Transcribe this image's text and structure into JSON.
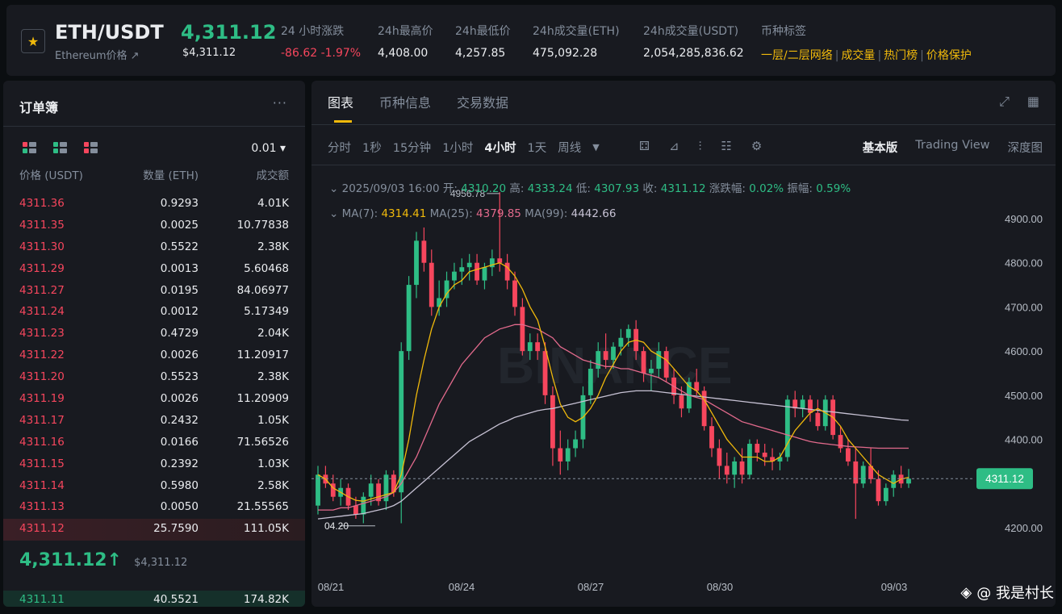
{
  "ticker": {
    "symbol": "ETH/USDT",
    "subtitle": "Ethereum价格 ↗",
    "last_price": "4,311.12",
    "last_price_usd": "$4,311.12",
    "stats": [
      {
        "label": "24 小时涨跌",
        "value": "-86.62 -1.97%",
        "tone": "red"
      },
      {
        "label": "24h最高价",
        "value": "4,408.00",
        "tone": "white"
      },
      {
        "label": "24h最低价",
        "value": "4,257.85",
        "tone": "white"
      },
      {
        "label": "24h成交量(ETH)",
        "value": "475,092.28",
        "tone": "white"
      },
      {
        "label": "24h成交量(USDT)",
        "value": "2,054,285,836.62",
        "tone": "white"
      }
    ],
    "tags_label": "币种标签",
    "tags": [
      "一层/二层网络",
      "成交量",
      "热门榜",
      "价格保护"
    ]
  },
  "orderbook": {
    "title": "订单簿",
    "more": "···",
    "precision": "0.01 ▾",
    "headers": {
      "price": "价格 (USDT)",
      "qty": "数量 (ETH)",
      "total": "成交额"
    },
    "asks": [
      {
        "p": "4311.36",
        "q": "0.9293",
        "t": "4.01K"
      },
      {
        "p": "4311.35",
        "q": "0.0025",
        "t": "10.77838"
      },
      {
        "p": "4311.30",
        "q": "0.5522",
        "t": "2.38K"
      },
      {
        "p": "4311.29",
        "q": "0.0013",
        "t": "5.60468"
      },
      {
        "p": "4311.27",
        "q": "0.0195",
        "t": "84.06977"
      },
      {
        "p": "4311.24",
        "q": "0.0012",
        "t": "5.17349"
      },
      {
        "p": "4311.23",
        "q": "0.4729",
        "t": "2.04K"
      },
      {
        "p": "4311.22",
        "q": "0.0026",
        "t": "11.20917"
      },
      {
        "p": "4311.20",
        "q": "0.5523",
        "t": "2.38K"
      },
      {
        "p": "4311.19",
        "q": "0.0026",
        "t": "11.20909"
      },
      {
        "p": "4311.17",
        "q": "0.2432",
        "t": "1.05K"
      },
      {
        "p": "4311.16",
        "q": "0.0166",
        "t": "71.56526"
      },
      {
        "p": "4311.15",
        "q": "0.2392",
        "t": "1.03K"
      },
      {
        "p": "4311.14",
        "q": "0.5980",
        "t": "2.58K"
      },
      {
        "p": "4311.13",
        "q": "0.0050",
        "t": "21.55565"
      },
      {
        "p": "4311.12",
        "q": "25.7590",
        "t": "111.05K"
      }
    ],
    "mid_price": "4,311.12↑",
    "mid_price_usd": "$4,311.12",
    "bid": {
      "p": "4311.11",
      "q": "40.5521",
      "t": "174.82K"
    }
  },
  "chart_panel": {
    "tabs": [
      "图表",
      "币种信息",
      "交易数据"
    ],
    "active_tab": 0,
    "intervals": [
      "分时",
      "1秒",
      "15分钟",
      "1小时",
      "4小时",
      "1天",
      "周线"
    ],
    "active_interval": 4,
    "views": [
      "基本版",
      "Trading View",
      "深度图"
    ],
    "active_view": 0,
    "ohlc": {
      "time": "2025/09/03 16:00",
      "open_label": "开:",
      "open": "4310.20",
      "high_label": "高:",
      "high": "4333.24",
      "low_label": "低:",
      "low": "4307.93",
      "close_label": "收:",
      "close": "4311.12",
      "change_label": "涨跌幅:",
      "change": "0.02%",
      "amp_label": "振幅:",
      "amp": "0.59%"
    },
    "ma": {
      "ma7_label": "MA(7):",
      "ma7": "4314.41",
      "ma25_label": "MA(25):",
      "ma25": "4379.85",
      "ma99_label": "MA(99):",
      "ma99": "4442.66"
    }
  },
  "chart_data": {
    "type": "candlestick",
    "y_ticks": [
      "4900.00",
      "4800.00",
      "4700.00",
      "4600.00",
      "4500.00",
      "4400.00",
      "4200.00"
    ],
    "ylim": [
      4180,
      4960
    ],
    "x_ticks": [
      "08/21",
      "08/24",
      "08/27",
      "08/30",
      "09/03"
    ],
    "current_price_label": "4311.12",
    "current_price": 4311.12,
    "max_annotation": "4956.78",
    "min_annotation": "04.20",
    "candles": [
      [
        4250,
        4340,
        4230,
        4320
      ],
      [
        4320,
        4340,
        4290,
        4300
      ],
      [
        4300,
        4320,
        4260,
        4270
      ],
      [
        4270,
        4310,
        4250,
        4290
      ],
      [
        4290,
        4300,
        4240,
        4250
      ],
      [
        4250,
        4270,
        4220,
        4230
      ],
      [
        4230,
        4280,
        4210,
        4270
      ],
      [
        4270,
        4320,
        4250,
        4300
      ],
      [
        4300,
        4310,
        4250,
        4260
      ],
      [
        4260,
        4330,
        4240,
        4320
      ],
      [
        4320,
        4330,
        4270,
        4280
      ],
      [
        4280,
        4620,
        4210,
        4600
      ],
      [
        4600,
        4770,
        4580,
        4750
      ],
      [
        4750,
        4870,
        4720,
        4850
      ],
      [
        4850,
        4880,
        4780,
        4800
      ],
      [
        4800,
        4830,
        4680,
        4700
      ],
      [
        4700,
        4760,
        4680,
        4720
      ],
      [
        4720,
        4780,
        4700,
        4760
      ],
      [
        4760,
        4800,
        4740,
        4780
      ],
      [
        4780,
        4810,
        4750,
        4790
      ],
      [
        4790,
        4820,
        4760,
        4800
      ],
      [
        4800,
        4820,
        4750,
        4760
      ],
      [
        4760,
        4800,
        4740,
        4790
      ],
      [
        4790,
        4830,
        4770,
        4810
      ],
      [
        4810,
        4960,
        4780,
        4800
      ],
      [
        4800,
        4820,
        4740,
        4760
      ],
      [
        4760,
        4780,
        4680,
        4700
      ],
      [
        4700,
        4720,
        4590,
        4600
      ],
      [
        4600,
        4640,
        4580,
        4620
      ],
      [
        4620,
        4640,
        4580,
        4600
      ],
      [
        4600,
        4620,
        4480,
        4500
      ],
      [
        4500,
        4520,
        4340,
        4380
      ],
      [
        4380,
        4420,
        4320,
        4350
      ],
      [
        4350,
        4400,
        4330,
        4380
      ],
      [
        4380,
        4420,
        4360,
        4400
      ],
      [
        4400,
        4520,
        4380,
        4500
      ],
      [
        4500,
        4580,
        4480,
        4560
      ],
      [
        4560,
        4620,
        4540,
        4600
      ],
      [
        4600,
        4640,
        4560,
        4580
      ],
      [
        4580,
        4620,
        4560,
        4610
      ],
      [
        4610,
        4650,
        4590,
        4630
      ],
      [
        4630,
        4660,
        4610,
        4650
      ],
      [
        4650,
        4670,
        4580,
        4600
      ],
      [
        4600,
        4610,
        4530,
        4550
      ],
      [
        4550,
        4580,
        4510,
        4560
      ],
      [
        4560,
        4620,
        4540,
        4600
      ],
      [
        4600,
        4610,
        4530,
        4540
      ],
      [
        4540,
        4560,
        4480,
        4500
      ],
      [
        4500,
        4520,
        4450,
        4470
      ],
      [
        4470,
        4540,
        4460,
        4530
      ],
      [
        4530,
        4560,
        4500,
        4510
      ],
      [
        4510,
        4520,
        4420,
        4430
      ],
      [
        4430,
        4450,
        4360,
        4380
      ],
      [
        4380,
        4400,
        4310,
        4340
      ],
      [
        4340,
        4370,
        4300,
        4320
      ],
      [
        4320,
        4360,
        4290,
        4350
      ],
      [
        4350,
        4380,
        4300,
        4320
      ],
      [
        4320,
        4400,
        4310,
        4390
      ],
      [
        4390,
        4400,
        4350,
        4370
      ],
      [
        4370,
        4390,
        4340,
        4360
      ],
      [
        4360,
        4380,
        4330,
        4350
      ],
      [
        4350,
        4370,
        4330,
        4360
      ],
      [
        4360,
        4500,
        4350,
        4490
      ],
      [
        4490,
        4510,
        4450,
        4470
      ],
      [
        4470,
        4500,
        4450,
        4490
      ],
      [
        4490,
        4500,
        4440,
        4460
      ],
      [
        4460,
        4490,
        4420,
        4430
      ],
      [
        4430,
        4500,
        4420,
        4490
      ],
      [
        4490,
        4500,
        4400,
        4410
      ],
      [
        4410,
        4430,
        4370,
        4380
      ],
      [
        4380,
        4400,
        4340,
        4350
      ],
      [
        4350,
        4380,
        4220,
        4300
      ],
      [
        4300,
        4350,
        4290,
        4340
      ],
      [
        4340,
        4380,
        4300,
        4310
      ],
      [
        4310,
        4330,
        4250,
        4260
      ],
      [
        4260,
        4300,
        4250,
        4290
      ],
      [
        4290,
        4330,
        4270,
        4320
      ],
      [
        4320,
        4340,
        4290,
        4300
      ],
      [
        4300,
        4333,
        4290,
        4311
      ]
    ],
    "ma7": [
      4320,
      4310,
      4290,
      4280,
      4270,
      4262,
      4260,
      4265,
      4270,
      4275,
      4280,
      4320,
      4400,
      4500,
      4580,
      4650,
      4700,
      4730,
      4750,
      4760,
      4780,
      4785,
      4790,
      4795,
      4800,
      4790,
      4770,
      4740,
      4700,
      4670,
      4610,
      4540,
      4480,
      4450,
      4440,
      4450,
      4470,
      4500,
      4540,
      4570,
      4600,
      4620,
      4625,
      4620,
      4600,
      4590,
      4580,
      4560,
      4540,
      4520,
      4510,
      4490,
      4460,
      4430,
      4400,
      4380,
      4360,
      4360,
      4360,
      4350,
      4350,
      4360,
      4390,
      4420,
      4440,
      4460,
      4470,
      4460,
      4450,
      4430,
      4400,
      4380,
      4360,
      4340,
      4320,
      4310,
      4300,
      4310,
      4314
    ],
    "ma25": [
      4240,
      4240,
      4240,
      4245,
      4245,
      4250,
      4255,
      4260,
      4265,
      4270,
      4280,
      4300,
      4330,
      4360,
      4400,
      4440,
      4480,
      4510,
      4540,
      4570,
      4590,
      4610,
      4630,
      4640,
      4650,
      4655,
      4660,
      4660,
      4655,
      4650,
      4640,
      4630,
      4610,
      4600,
      4590,
      4580,
      4575,
      4570,
      4565,
      4565,
      4560,
      4560,
      4555,
      4550,
      4545,
      4540,
      4530,
      4520,
      4510,
      4500,
      4495,
      4490,
      4480,
      4470,
      4460,
      4450,
      4440,
      4435,
      4430,
      4425,
      4420,
      4415,
      4410,
      4405,
      4400,
      4395,
      4392,
      4390,
      4388,
      4386,
      4384,
      4383,
      4382,
      4381,
      4380,
      4380,
      4380,
      4380,
      4380
    ],
    "ma99": [
      4220,
      4222,
      4224,
      4226,
      4228,
      4230,
      4232,
      4236,
      4240,
      4244,
      4250,
      4260,
      4275,
      4290,
      4305,
      4320,
      4335,
      4350,
      4365,
      4380,
      4395,
      4405,
      4415,
      4425,
      4435,
      4442,
      4450,
      4455,
      4460,
      4465,
      4468,
      4470,
      4474,
      4478,
      4482,
      4486,
      4490,
      4494,
      4498,
      4502,
      4506,
      4508,
      4510,
      4510,
      4510,
      4508,
      4506,
      4504,
      4502,
      4500,
      4498,
      4496,
      4494,
      4492,
      4490,
      4488,
      4486,
      4484,
      4482,
      4480,
      4478,
      4476,
      4474,
      4472,
      4470,
      4468,
      4466,
      4464,
      4462,
      4460,
      4458,
      4456,
      4454,
      4452,
      4450,
      4448,
      4446,
      4444,
      4443
    ]
  },
  "colors": {
    "up": "#2ebd85",
    "down": "#f6465d",
    "ma7": "#f0b90b",
    "ma25": "#e26a8c",
    "ma99": "#c7c2d4",
    "accent": "#f0b90b"
  },
  "watermark": {
    "chart": "BINANCE",
    "footer": "@ 我是村长"
  }
}
